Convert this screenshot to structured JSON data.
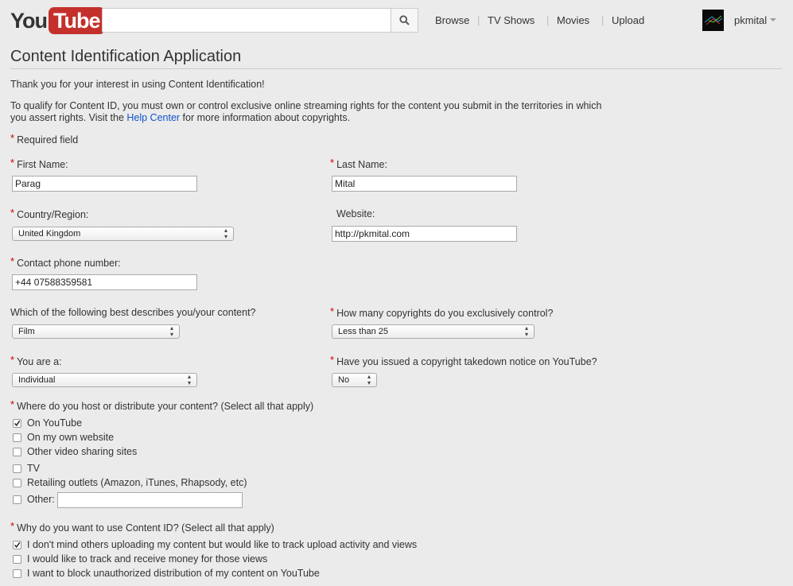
{
  "header": {
    "logo_you": "You",
    "logo_tube": "Tube",
    "search_value": "",
    "nav": [
      "Browse",
      "TV Shows",
      "Movies",
      "Upload"
    ],
    "username": "pkmital"
  },
  "title": "Content Identification Application",
  "intro": "Thank you for your interest in using Content Identification!",
  "qualify_part1": "To qualify for Content ID, you must own or control exclusive online streaming rights for the content you submit in the territories in which",
  "qualify_part2": "you assert rights. Visit the ",
  "help_link": "Help Center",
  "qualify_part3": " for more information about copyrights.",
  "required_note": "Required field",
  "fields": {
    "first_name": {
      "label": "First Name:",
      "value": "Parag"
    },
    "last_name": {
      "label": "Last Name:",
      "value": "Mital"
    },
    "country": {
      "label": "Country/Region:",
      "value": "United Kingdom"
    },
    "website": {
      "label": "Website:",
      "value": "http://pkmital.com"
    },
    "phone": {
      "label": "Contact phone number:",
      "value": "+44 07588359581"
    },
    "describes": {
      "label": "Which of the following best describes you/your content?",
      "value": "Film"
    },
    "copyrights": {
      "label": "How many copyrights do you exclusively control?",
      "value": "Less than 25"
    },
    "you_are": {
      "label": "You are a:",
      "value": "Individual"
    },
    "takedown": {
      "label": "Have you issued a copyright takedown notice on YouTube?",
      "value": "No"
    }
  },
  "host": {
    "label": "Where do you host or distribute your content? (Select all that apply)",
    "options": [
      {
        "label": "On YouTube",
        "checked": true
      },
      {
        "label": "On my own website",
        "checked": false
      },
      {
        "label": "Other video sharing sites",
        "checked": false
      },
      {
        "label": "TV",
        "checked": false
      },
      {
        "label": "Retailing outlets (Amazon, iTunes, Rhapsody, etc)",
        "checked": false
      },
      {
        "label": "Other:",
        "checked": false
      }
    ],
    "other_value": ""
  },
  "why": {
    "label": "Why do you want to use Content ID? (Select all that apply)",
    "options": [
      {
        "label": "I don't mind others uploading my content but would like to track upload activity and views",
        "checked": true
      },
      {
        "label": "I would like to track and receive money for those views",
        "checked": false
      },
      {
        "label": "I want to block unauthorized distribution of my content on YouTube",
        "checked": false
      }
    ]
  },
  "colors": {
    "brand_red": "#c4302b",
    "required_red": "#cc0000",
    "link_blue": "#1155cc"
  }
}
